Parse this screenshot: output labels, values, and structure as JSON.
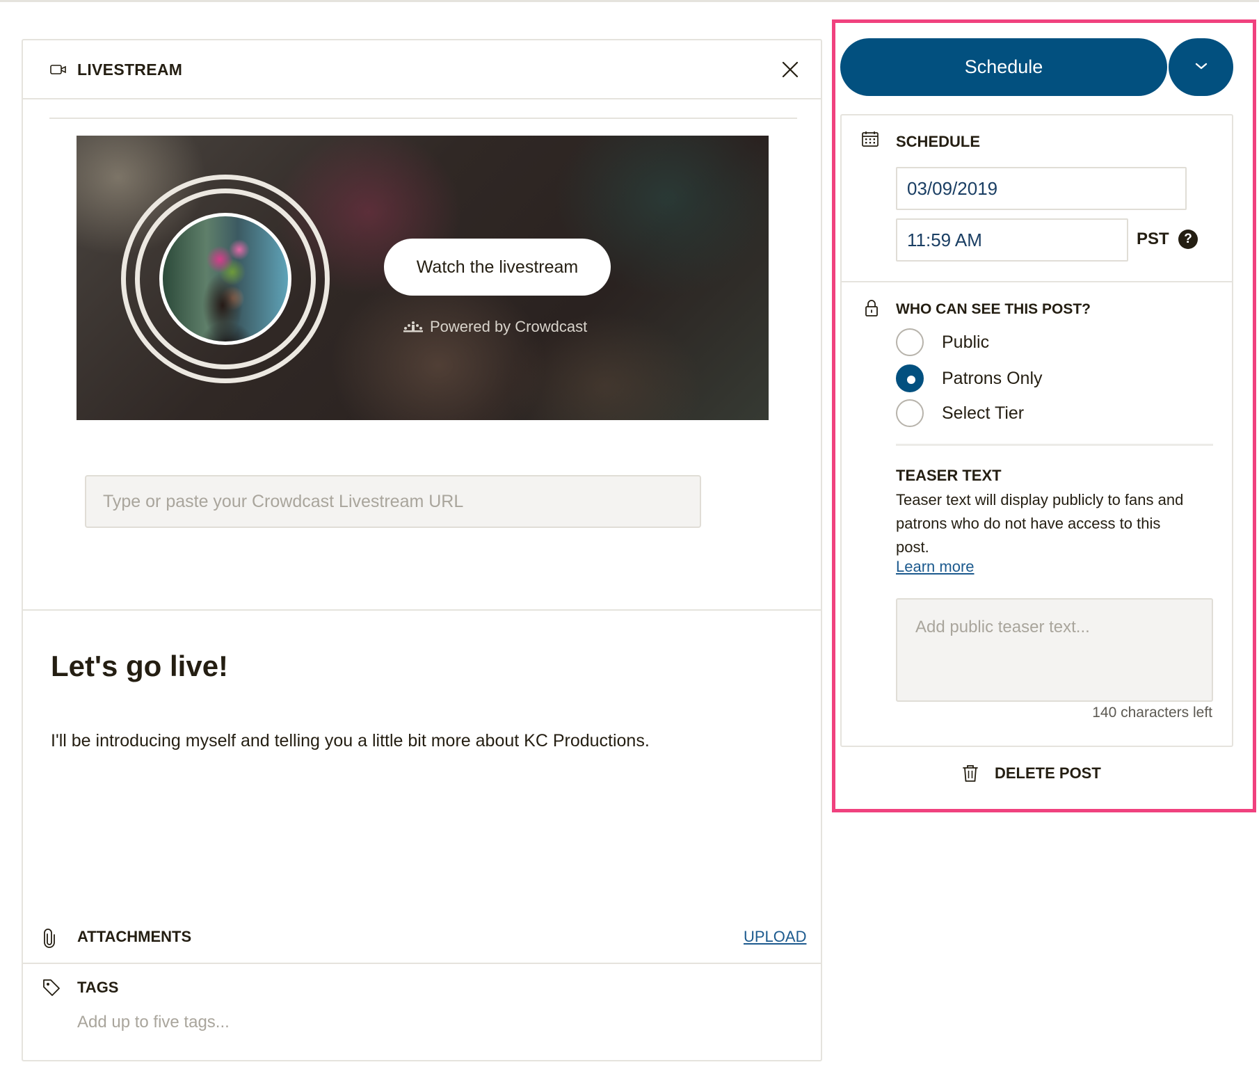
{
  "livestream": {
    "header_title": "LIVESTREAM",
    "watch_button": "Watch the livestream",
    "powered_by": "Powered by Crowdcast",
    "url_placeholder": "Type or paste your Crowdcast Livestream URL"
  },
  "post": {
    "title": "Let's go live!",
    "body": "I'll be introducing myself and telling you a little bit more about KC Productions."
  },
  "attachments": {
    "label": "ATTACHMENTS",
    "upload_link": "UPLOAD"
  },
  "tags": {
    "label": "TAGS",
    "placeholder": "Add up to five tags..."
  },
  "actions": {
    "schedule_button": "Schedule"
  },
  "schedule": {
    "label": "SCHEDULE",
    "date": "03/09/2019",
    "time": "11:59 AM",
    "timezone": "PST",
    "help_glyph": "?"
  },
  "visibility": {
    "label": "WHO CAN SEE THIS POST?",
    "options": [
      {
        "label": "Public",
        "checked": false
      },
      {
        "label": "Patrons Only",
        "checked": true
      },
      {
        "label": "Select Tier",
        "checked": false
      }
    ]
  },
  "teaser": {
    "label": "TEASER TEXT",
    "description": "Teaser text will display publicly to fans and patrons who do not have access to this post.",
    "learn_more": "Learn more",
    "placeholder": "Add public teaser text...",
    "chars_left": "140 characters left"
  },
  "delete": {
    "label": "DELETE POST"
  },
  "colors": {
    "primary": "#02507f",
    "highlight_border": "#f0417e",
    "link": "#1c5a8e",
    "text": "#241e12"
  },
  "icons": [
    "video-camera-icon",
    "close-icon",
    "audience-icon",
    "chevron-down-icon",
    "calendar-icon",
    "help-icon",
    "lock-icon",
    "paperclip-icon",
    "tag-icon",
    "trash-icon"
  ]
}
